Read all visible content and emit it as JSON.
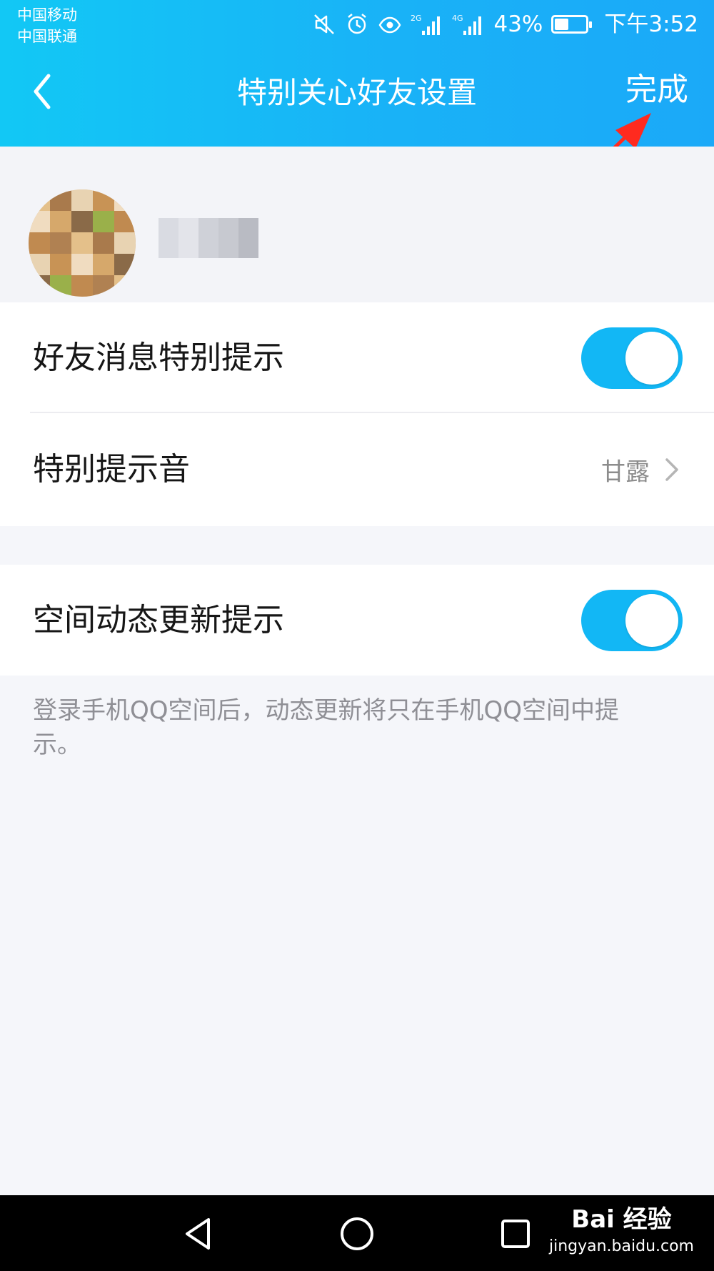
{
  "status_bar": {
    "carrier_1": "中国移动",
    "carrier_2": "中国联通",
    "signal_1_label": "2G",
    "signal_2_label": "4G",
    "battery_percent": "43%",
    "battery_level": 0.43,
    "time": "下午3:52",
    "icons": [
      "mute-icon",
      "alarm-icon",
      "eye-icon",
      "signal-icon",
      "battery-icon"
    ]
  },
  "header": {
    "title": "特别关心好友设置",
    "done_label": "完成",
    "back_icon": "chevron-left-icon"
  },
  "settings": {
    "friend_message_alert": {
      "label": "好友消息特别提示",
      "enabled": true
    },
    "special_alert_sound": {
      "label": "特别提示音",
      "value": "甘露"
    },
    "space_update_alert": {
      "label": "空间动态更新提示",
      "enabled": true
    }
  },
  "description": "登录手机QQ空间后，动态更新将只在手机QQ空间中提示。",
  "watermark": {
    "brand": "Bai 经验",
    "url": "jingyan.baidu.com"
  },
  "colors": {
    "header_start": "#12c8f5",
    "header_end": "#1ba9f8",
    "switch_on": "#12b7f5",
    "annotation": "#ff2a1f"
  }
}
